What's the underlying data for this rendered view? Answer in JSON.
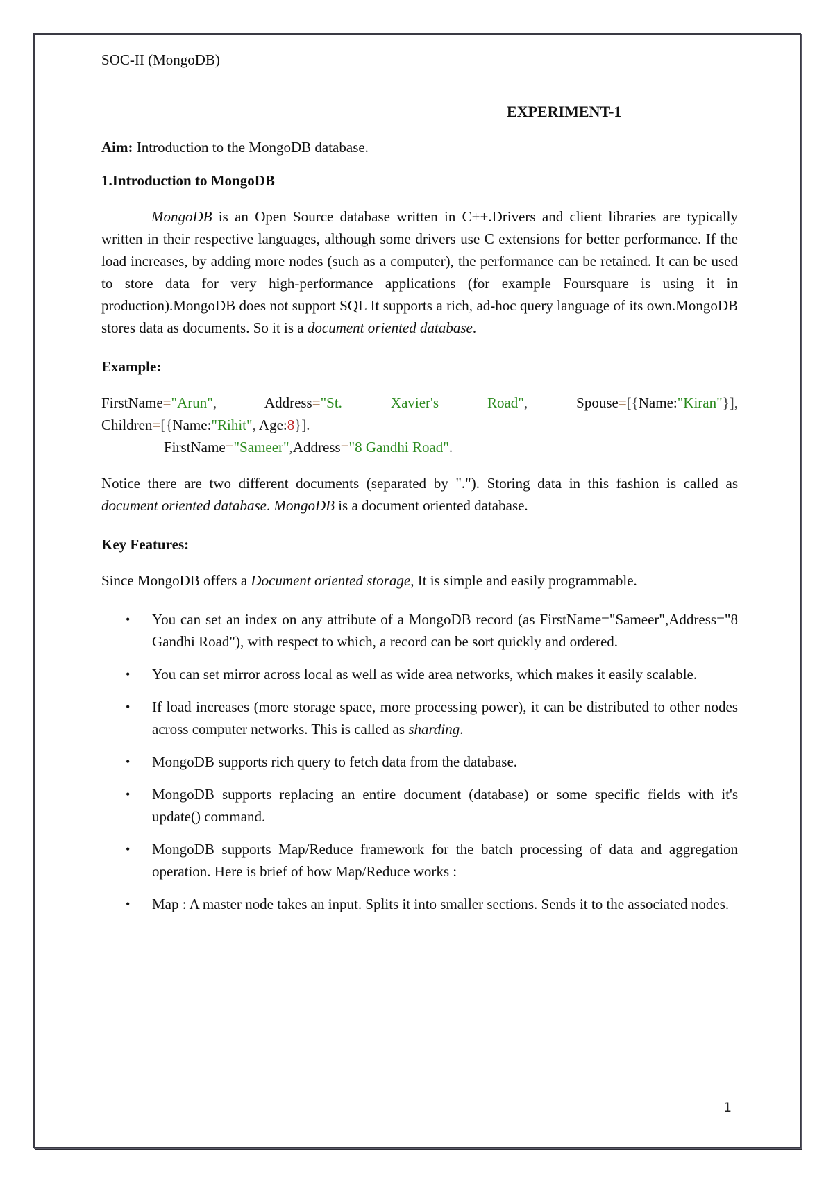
{
  "header": {
    "running_title": "SOC-II (MongoDB)"
  },
  "title": "EXPERIMENT-1",
  "aim": {
    "label": "Aim:",
    "text": " Introduction to the MongoDB database."
  },
  "section1": {
    "heading": "1.Introduction to MongoDB",
    "intro_italic_lead": "MongoDB",
    "intro_text": " is an Open Source database written in C++.Drivers and client libraries are typically written in their respective languages, although some drivers use C extensions for better performance. If the load increases, by adding more nodes (such as a computer), the performance can be retained. It can be used to store data for very high-performance applications (for example Foursquare is using it in production).MongoDB does not support SQL It supports a rich, ad-hoc query language of its own.MongoDB stores data as documents. So it is a ",
    "intro_italic_tail": "document oriented database",
    "intro_end": "."
  },
  "example": {
    "heading": "Example:",
    "doc1": {
      "firstname_key": "FirstName",
      "firstname_val": "\"Arun\"",
      "address_key": "Address",
      "address_val": "\"St. Xavier's Road\"",
      "spouse_key": "Spouse",
      "spouse_name_key": "Name:",
      "spouse_name_val": "\"Kiran\"",
      "children_key": "Children",
      "child_name_key": "Name:",
      "child_name_val": "\"Rihit\"",
      "child_age_key": "Age:",
      "child_age_val": "8"
    },
    "doc2": {
      "firstname_key": "FirstName",
      "firstname_val": "\"Sameer\"",
      "address_key": "Address",
      "address_val": "\"8 Gandhi Road\""
    }
  },
  "notice": {
    "text1": "Notice there are two different documents (separated by \".\"). Storing data in this fashion is called as ",
    "italic1": "document oriented database",
    "text2": ". ",
    "italic2": "MongoDB",
    "text3": " is a document oriented database."
  },
  "key_features": {
    "heading": "Key Features:",
    "since_text1": "Since MongoDB offers a ",
    "since_italic": "Document oriented storage",
    "since_text2": ", It is simple and easily programmable.",
    "bullet_glyph": "•",
    "items": [
      {
        "text": "You can set an index on any attribute of a MongoDB record (as FirstName=\"Sameer\",Address=\"8 Gandhi Road\"), with respect to which, a record can be sort quickly and ordered."
      },
      {
        "text": "You can set mirror across local as well as wide area networks, which makes it easily scalable."
      },
      {
        "text": "If load increases (more storage space, more processing power), it can be distributed to other nodes across computer networks. This is called as ",
        "italic": "sharding",
        "end": "."
      },
      {
        "text": "MongoDB supports rich query to fetch data from the database."
      },
      {
        "text": "MongoDB supports replacing an entire document (database) or some specific fields with it's update() command."
      },
      {
        "text": "MongoDB supports Map/Reduce framework for the batch processing of data and aggregation operation. Here is brief of how Map/Reduce works :"
      },
      {
        "text": "Map : A master node takes an input. Splits it into smaller sections. Sends it to the associated nodes."
      }
    ]
  },
  "footer": {
    "page_number": "1"
  },
  "colors": {
    "string_value": "#2b8a1e",
    "number_value": "#c0282a",
    "equals_sign": "#b08a6a",
    "frame_border": "#3a3a44"
  }
}
